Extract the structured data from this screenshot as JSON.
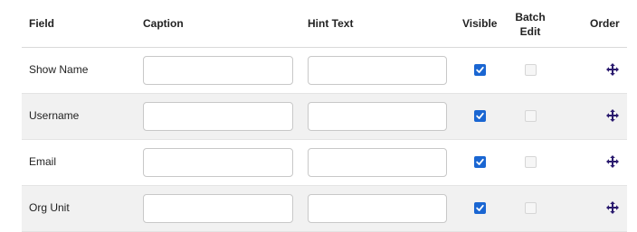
{
  "header": {
    "field": "Field",
    "caption": "Caption",
    "hint_text": "Hint Text",
    "visible": "Visible",
    "batch_edit": "Batch Edit",
    "order": "Order"
  },
  "rows": [
    {
      "field": "Show Name",
      "caption_value": "",
      "hint_value": "",
      "visible": true,
      "batch_edit": false,
      "batch_edit_enabled": false
    },
    {
      "field": "Username",
      "caption_value": "",
      "hint_value": "",
      "visible": true,
      "batch_edit": false,
      "batch_edit_enabled": false
    },
    {
      "field": "Email",
      "caption_value": "",
      "hint_value": "",
      "visible": true,
      "batch_edit": false,
      "batch_edit_enabled": false
    },
    {
      "field": "Org Unit",
      "caption_value": "",
      "hint_value": "",
      "visible": true,
      "batch_edit": false,
      "batch_edit_enabled": false
    }
  ],
  "icons": {
    "order": "move-arrows-icon",
    "visible_checked": "checkmark-icon"
  },
  "colors": {
    "checkbox_checked": "#1a66d2",
    "drag_icon": "#2a1a6e",
    "alt_row": "#f1f1f1"
  }
}
